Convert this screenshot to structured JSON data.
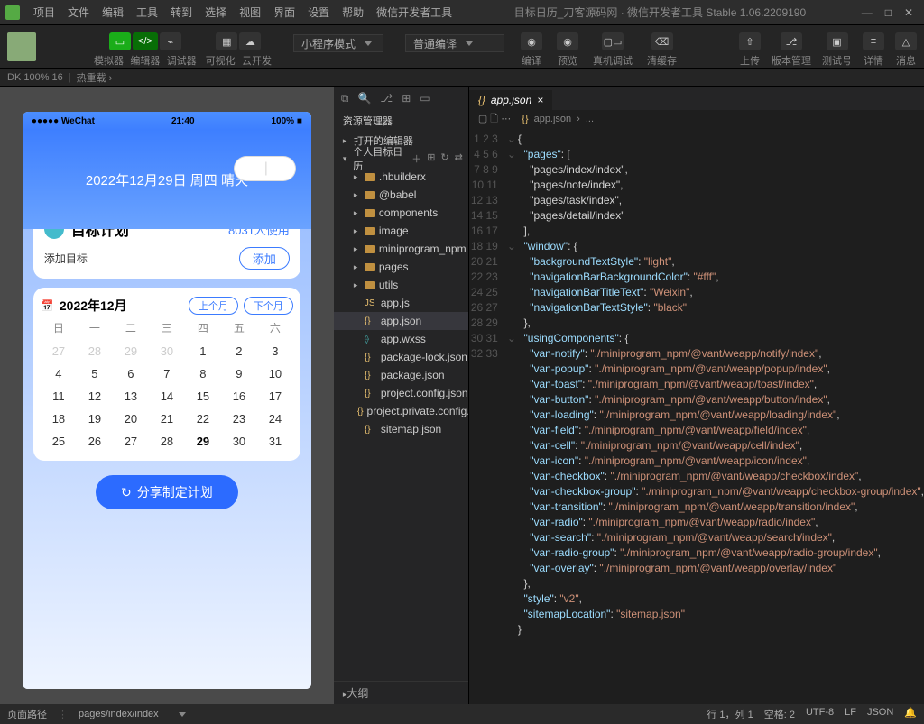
{
  "menu": {
    "items": [
      "项目",
      "文件",
      "编辑",
      "工具",
      "转到",
      "选择",
      "视图",
      "界面",
      "设置",
      "帮助",
      "微信开发者工具"
    ]
  },
  "windowTitle": "目标日历_刀客源码网 · 微信开发者工具 Stable 1.06.2209190",
  "toolbar": {
    "labels": {
      "simulator": "模拟器",
      "editor": "编辑器",
      "debugger": "调试器",
      "visualization": "可视化",
      "clouddev": "云开发"
    },
    "modeSel": "小程序模式",
    "compileSel": "普通编译",
    "center": {
      "compile": "编译",
      "preview": "预览",
      "realdebug": "真机调试",
      "clearCache": "清缓存"
    },
    "right": {
      "upload": "上传",
      "version": "版本管理",
      "testNum": "测试号",
      "details": "详情",
      "news": "消息"
    }
  },
  "inforow": {
    "device": "DK 100% 16",
    "hot": "热重载 ›"
  },
  "pageRouteLabel": "页面路径",
  "pageRoute": "pages/index/index",
  "sim": {
    "statusLeft": "●●●●● WeChat",
    "time": "21:40",
    "battery": "100% ■",
    "dateLine": "2022年12月29日 周四 晴天",
    "planTitle": "目标计划",
    "planUsers": "8031人使用",
    "addGoal": "添加目标",
    "addBtn": "添加",
    "calMonth": "2022年12月",
    "prevMonth": "上个月",
    "nextMonth": "下个月",
    "dow": [
      "日",
      "一",
      "二",
      "三",
      "四",
      "五",
      "六"
    ],
    "grid": [
      {
        "d": "27",
        "o": true
      },
      {
        "d": "28",
        "o": true
      },
      {
        "d": "29",
        "o": true
      },
      {
        "d": "30",
        "o": true
      },
      {
        "d": "1"
      },
      {
        "d": "2"
      },
      {
        "d": "3"
      },
      {
        "d": "4"
      },
      {
        "d": "5"
      },
      {
        "d": "6"
      },
      {
        "d": "7"
      },
      {
        "d": "8"
      },
      {
        "d": "9"
      },
      {
        "d": "10"
      },
      {
        "d": "11"
      },
      {
        "d": "12"
      },
      {
        "d": "13"
      },
      {
        "d": "14"
      },
      {
        "d": "15"
      },
      {
        "d": "16"
      },
      {
        "d": "17"
      },
      {
        "d": "18"
      },
      {
        "d": "19"
      },
      {
        "d": "20"
      },
      {
        "d": "21"
      },
      {
        "d": "22"
      },
      {
        "d": "23"
      },
      {
        "d": "24"
      },
      {
        "d": "25"
      },
      {
        "d": "26"
      },
      {
        "d": "27"
      },
      {
        "d": "28"
      },
      {
        "d": "29",
        "t": true
      },
      {
        "d": "30"
      },
      {
        "d": "31"
      }
    ],
    "shareBtn": "分享制定计划"
  },
  "explorer": {
    "title": "资源管理器",
    "openEditors": "打开的编辑器",
    "projectName": "个人目标日历",
    "folders": [
      ".hbuilderx",
      "@babel",
      "components",
      "image",
      "miniprogram_npm",
      "pages",
      "utils"
    ],
    "files": [
      "app.js",
      "app.json",
      "app.wxss",
      "package-lock.json",
      "package.json",
      "project.config.json",
      "project.private.config.js...",
      "sitemap.json"
    ],
    "outline": "大纲"
  },
  "tab": {
    "name": "app.json"
  },
  "breadcrumb": {
    "fileicon": "{}",
    "file": "app.json",
    "sep": "›",
    "dots": "..."
  },
  "code": {
    "lines": [
      "{",
      "  \"pages\": [",
      "    \"pages/index/index\",",
      "    \"pages/note/index\",",
      "    \"pages/task/index\",",
      "    \"pages/detail/index\"",
      "  ],",
      "  \"window\": {",
      "    \"backgroundTextStyle\": \"light\",",
      "    \"navigationBarBackgroundColor\": \"#fff\",",
      "    \"navigationBarTitleText\": \"Weixin\",",
      "    \"navigationBarTextStyle\": \"black\"",
      "  },",
      "  \"usingComponents\": {",
      "    \"van-notify\": \"./miniprogram_npm/@vant/weapp/notify/index\",",
      "    \"van-popup\": \"./miniprogram_npm/@vant/weapp/popup/index\",",
      "    \"van-toast\": \"./miniprogram_npm/@vant/weapp/toast/index\",",
      "    \"van-button\": \"./miniprogram_npm/@vant/weapp/button/index\",",
      "    \"van-loading\": \"./miniprogram_npm/@vant/weapp/loading/index\",",
      "    \"van-field\": \"./miniprogram_npm/@vant/weapp/field/index\",",
      "    \"van-cell\": \"./miniprogram_npm/@vant/weapp/cell/index\",",
      "    \"van-icon\": \"./miniprogram_npm/@vant/weapp/icon/index\",",
      "    \"van-checkbox\": \"./miniprogram_npm/@vant/weapp/checkbox/index\",",
      "    \"van-checkbox-group\": \"./miniprogram_npm/@vant/weapp/checkbox-group/index\",",
      "    \"van-transition\": \"./miniprogram_npm/@vant/weapp/transition/index\",",
      "    \"van-radio\": \"./miniprogram_npm/@vant/weapp/radio/index\",",
      "    \"van-search\": \"./miniprogram_npm/@vant/weapp/search/index\",",
      "    \"van-radio-group\": \"./miniprogram_npm/@vant/weapp/radio-group/index\",",
      "    \"van-overlay\": \"./miniprogram_npm/@vant/weapp/overlay/index\"",
      "  },",
      "  \"style\": \"v2\",",
      "  \"sitemapLocation\": \"sitemap.json\"",
      "}"
    ]
  },
  "status": {
    "left": "",
    "pos": "行 1，列 1",
    "spaces": "空格: 2",
    "enc": "UTF-8",
    "eol": "LF",
    "lang": "JSON",
    "bell": ""
  }
}
